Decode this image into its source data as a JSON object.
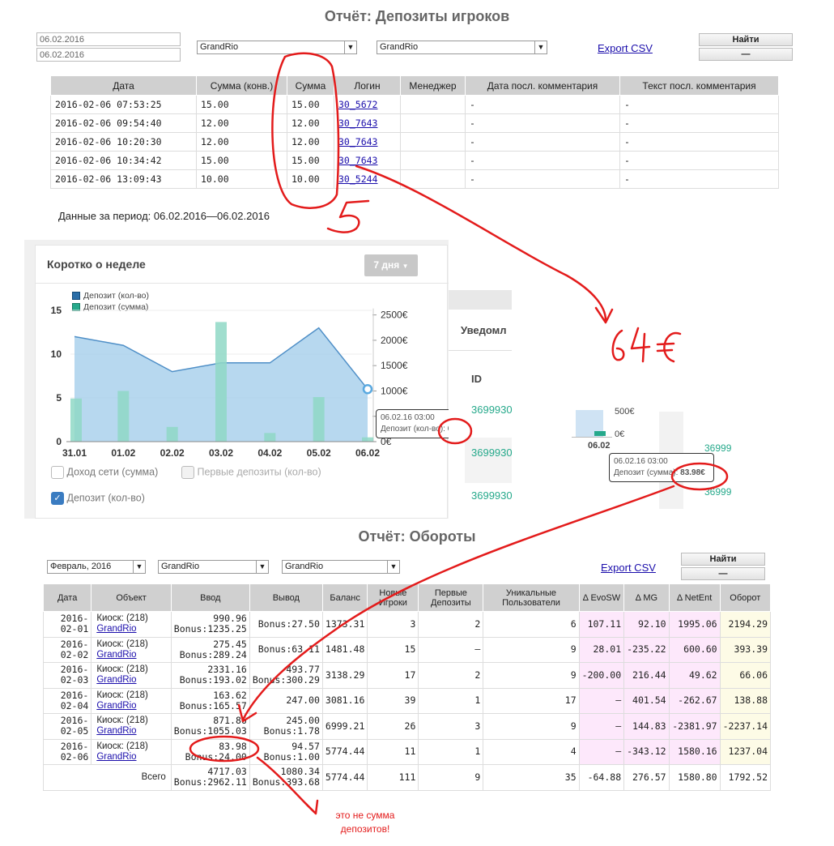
{
  "report1": {
    "title": "Отчёт: Депозиты игроков",
    "date_from": "06.02.2016",
    "date_to": "06.02.2016",
    "select1": "GrandRio",
    "select2": "GrandRio",
    "export": "Export CSV",
    "find": "Найти",
    "dash": "—",
    "headers": [
      "Дата",
      "Сумма (конв.)",
      "Сумма",
      "Логин",
      "Менеджер",
      "Дата посл. комментария",
      "Текст посл. комментария"
    ],
    "rows": [
      {
        "date": "2016-02-06 07:53:25",
        "conv": "15.00",
        "sum": "15.00",
        "login": "30_5672",
        "mgr": "",
        "cdate": "-",
        "ctext": "-"
      },
      {
        "date": "2016-02-06 09:54:40",
        "conv": "12.00",
        "sum": "12.00",
        "login": "30_7643",
        "mgr": "",
        "cdate": "-",
        "ctext": "-"
      },
      {
        "date": "2016-02-06 10:20:30",
        "conv": "12.00",
        "sum": "12.00",
        "login": "30_7643",
        "mgr": "",
        "cdate": "-",
        "ctext": "-"
      },
      {
        "date": "2016-02-06 10:34:42",
        "conv": "15.00",
        "sum": "15.00",
        "login": "30_7643",
        "mgr": "",
        "cdate": "-",
        "ctext": "-"
      },
      {
        "date": "2016-02-06 13:09:43",
        "conv": "10.00",
        "sum": "10.00",
        "login": "30_5244",
        "mgr": "",
        "cdate": "-",
        "ctext": "-"
      }
    ],
    "period": "Данные за период: 06.02.2016—06.02.2016"
  },
  "widget": {
    "title": "Коротко о неделе",
    "range_btn": "7 дня",
    "legend": [
      "Депозит (кол-во)",
      "Депозит (сумма)"
    ],
    "checkboxes": [
      {
        "label": "Доход сети (сумма)",
        "checked": false
      },
      {
        "label": "Первые депозиты (кол-во)",
        "checked": false
      },
      {
        "label": "Депозит (кол-во)",
        "checked": true
      }
    ],
    "tooltip_date": "06.02.16 03:00",
    "tooltip_label": "Депозит (кол-во): ",
    "tooltip_value": "6"
  },
  "side_panel": {
    "title": "Уведомл",
    "id_header": "ID",
    "ids": [
      "3699930",
      "3699930",
      "3699930"
    ]
  },
  "mini": {
    "tick": "500€",
    "zero": "0€",
    "date": "06.02",
    "tooltip_date": "06.02.16 03:00",
    "tooltip_label": "Депозит (сумма): ",
    "tooltip_value": "83.98€",
    "ids": [
      "36999",
      "36999"
    ]
  },
  "annotations": {
    "five": "5",
    "amount": "64€",
    "note": "это не сумма депозитов!"
  },
  "chart_data": {
    "type": "line",
    "categories": [
      "31.01",
      "01.02",
      "02.02",
      "03.02",
      "04.02",
      "05.02",
      "06.02"
    ],
    "series": [
      {
        "name": "Депозит (кол-во)",
        "type": "area",
        "axis": "left",
        "values": [
          12,
          11,
          8,
          9,
          9,
          13,
          6
        ]
      },
      {
        "name": "Депозит (сумма)",
        "type": "bar",
        "axis": "right",
        "values": [
          850,
          1000,
          290,
          2360,
          170,
          880,
          85
        ]
      }
    ],
    "y_left": {
      "ticks": [
        0,
        5,
        10,
        15
      ],
      "range": [
        0,
        15
      ]
    },
    "y_right": {
      "ticks": [
        "0€",
        "500€",
        "1000€",
        "1500€",
        "2000€",
        "2500€"
      ],
      "range": [
        0,
        2750
      ]
    },
    "colors": {
      "area": "#9fcbea",
      "area_line": "#4f8fc7",
      "bar": "#8fd8c6"
    }
  },
  "report2": {
    "title": "Отчёт: Обороты",
    "month": "Февраль, 2016",
    "select1": "GrandRio",
    "select2": "GrandRio",
    "export": "Export CSV",
    "find": "Найти",
    "dash": "—",
    "headers": [
      "Дата",
      "Объект",
      "Ввод",
      "Вывод",
      "Баланс",
      "Новые Игроки",
      "Первые Депозиты",
      "Уникальные Пользователи",
      "Δ EvoSW",
      "Δ MG",
      "Δ NetEnt",
      "Оборот"
    ],
    "rows": [
      {
        "d1": "2016-",
        "d2": "02-01",
        "obj": "Киоск: (218)",
        "link": "GrandRio",
        "in1": "990.96",
        "in2": "Bonus:1235.25",
        "out1": "Bonus:27.50",
        "out2": "",
        "bal": "1373.31",
        "np": "3",
        "fd": "2",
        "uu": "6",
        "evo": "107.11",
        "mg": "92.10",
        "ne": "1995.06",
        "ob": "2194.29"
      },
      {
        "d1": "2016-",
        "d2": "02-02",
        "obj": "Киоск: (218)",
        "link": "GrandRio",
        "in1": "275.45",
        "in2": "Bonus:289.24",
        "out1": "Bonus:63.11",
        "out2": "",
        "bal": "1481.48",
        "np": "15",
        "fd": "—",
        "uu": "9",
        "evo": "28.01",
        "mg": "-235.22",
        "ne": "600.60",
        "ob": "393.39"
      },
      {
        "d1": "2016-",
        "d2": "02-03",
        "obj": "Киоск: (218)",
        "link": "GrandRio",
        "in1": "2331.16",
        "in2": "Bonus:193.02",
        "out1": "493.77",
        "out2": "Bonus:300.29",
        "bal": "3138.29",
        "np": "17",
        "fd": "2",
        "uu": "9",
        "evo": "-200.00",
        "mg": "216.44",
        "ne": "49.62",
        "ob": "66.06"
      },
      {
        "d1": "2016-",
        "d2": "02-04",
        "obj": "Киоск: (218)",
        "link": "GrandRio",
        "in1": "163.62",
        "in2": "Bonus:165.57",
        "out1": "247.00",
        "out2": "",
        "bal": "3081.16",
        "np": "39",
        "fd": "1",
        "uu": "17",
        "evo": "—",
        "mg": "401.54",
        "ne": "-262.67",
        "ob": "138.88"
      },
      {
        "d1": "2016-",
        "d2": "02-05",
        "obj": "Киоск: (218)",
        "link": "GrandRio",
        "in1": "871.86",
        "in2": "Bonus:1055.03",
        "out1": "245.00",
        "out2": "Bonus:1.78",
        "bal": "6999.21",
        "np": "26",
        "fd": "3",
        "uu": "9",
        "evo": "—",
        "mg": "144.83",
        "ne": "-2381.97",
        "ob": "-2237.14"
      },
      {
        "d1": "2016-",
        "d2": "02-06",
        "obj": "Киоск: (218)",
        "link": "GrandRio",
        "in1": "83.98",
        "in2": "Bonus:24.00",
        "out1": "94.57",
        "out2": "Bonus:1.00",
        "bal": "5774.44",
        "np": "11",
        "fd": "1",
        "uu": "4",
        "evo": "—",
        "mg": "-343.12",
        "ne": "1580.16",
        "ob": "1237.04"
      }
    ],
    "total": {
      "label": "Всего",
      "in1": "4717.03",
      "in2": "Bonus:2962.11",
      "out1": "1080.34",
      "out2": "Bonus:393.68",
      "bal": "5774.44",
      "np": "111",
      "fd": "9",
      "uu": "35",
      "evo": "-64.88",
      "mg": "276.57",
      "ne": "1580.80",
      "ob": "1792.52"
    }
  }
}
